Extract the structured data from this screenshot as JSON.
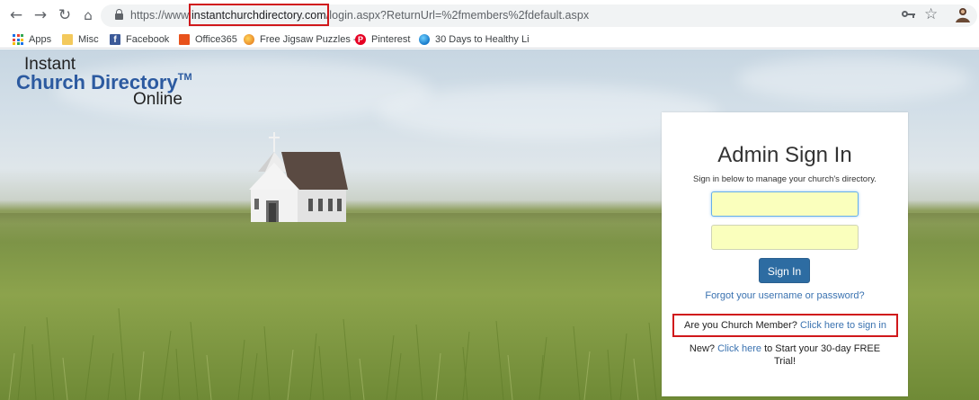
{
  "browser": {
    "url_prefix": "https://www.",
    "url_domain": "instantchurchdirectory.com",
    "url_path": "/login.aspx?ReturnUrl=%2fmembers%2fdefault.aspx",
    "nav_icons": [
      "back-arrow-icon",
      "forward-arrow-icon",
      "reload-icon",
      "home-icon"
    ]
  },
  "bookmarks": [
    {
      "label": "Apps",
      "icon": "apps-grid-icon"
    },
    {
      "label": "Misc",
      "icon": "folder-icon"
    },
    {
      "label": "Facebook",
      "icon": "facebook-icon"
    },
    {
      "label": "Office365",
      "icon": "office-icon"
    },
    {
      "label": "Free Jigsaw Puzzles -",
      "icon": "jigsaw-icon"
    },
    {
      "label": "Pinterest",
      "icon": "pinterest-icon"
    },
    {
      "label": "30 Days to Healthy Li",
      "icon": "globe-icon"
    }
  ],
  "logo": {
    "line1": "Instant",
    "line2": "Church Directory",
    "trademark": "TM",
    "line3": "Online"
  },
  "signin": {
    "title": "Admin Sign In",
    "subtitle": "Sign in below to manage your church's directory.",
    "username_value": "",
    "password_value": "",
    "button": "Sign In",
    "forgot": "Forgot your username or password?",
    "member_prefix": "Are you Church Member?",
    "member_link": "Click here to sign in",
    "new_prefix": "New?",
    "new_link": "Click here",
    "new_suffix": "to Start your 30-day FREE Trial!"
  },
  "colors": {
    "accent": "#2d6ca2",
    "link": "#3a72b0",
    "highlight_box": "#d0181b",
    "autofill": "#faffbd"
  }
}
